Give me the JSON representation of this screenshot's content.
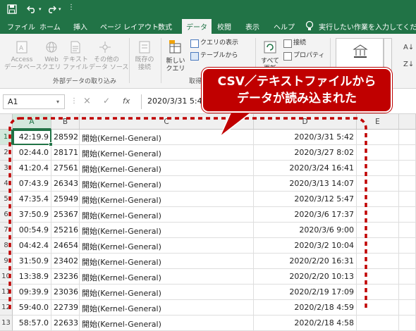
{
  "quick_access": {
    "save_icon": "save-icon",
    "undo_icon": "undo-icon",
    "redo_icon": "redo-icon",
    "customize_icon": "customize-icon"
  },
  "tabs": [
    "ファイル",
    "ホーム",
    "挿入",
    "ページ レイアウト",
    "数式",
    "データ",
    "校閲",
    "表示",
    "ヘルプ"
  ],
  "active_tab": "データ",
  "tell_me": "実行したい作業を入力してください",
  "ribbon": {
    "external_data": [
      "Access\nデータベース",
      "Web\nクエリ",
      "テキスト\nファイル",
      "その他の\nデータ ソース",
      "既存の\n接続"
    ],
    "external_data_group": "外部データの取り込み",
    "new_query": "新しい\nクエリ",
    "show_queries": "クエリの表示",
    "from_table": "テーブルから",
    "get_transform_group": "取得",
    "connections": "接続",
    "properties": "プロパティ",
    "refresh_all": "すべて\n更新"
  },
  "formula_bar": {
    "name_box": "A1",
    "cancel": "×",
    "enter": "✓",
    "fx": "fx",
    "value": "2020/3/31 5:42"
  },
  "callout": {
    "line1": "CSV／テキストファイルから",
    "line2": "データが読み込まれた"
  },
  "columns": [
    "A",
    "B",
    "C",
    "D",
    "E"
  ],
  "rows": [
    {
      "n": "1",
      "a": "42:19.9",
      "b": "28592",
      "c": "開始(Kernel-General)",
      "d": "2020/3/31 5:42"
    },
    {
      "n": "2",
      "a": "02:44.0",
      "b": "28171",
      "c": "開始(Kernel-General)",
      "d": "2020/3/27 8:02"
    },
    {
      "n": "3",
      "a": "41:20.4",
      "b": "27561",
      "c": "開始(Kernel-General)",
      "d": "2020/3/24 16:41"
    },
    {
      "n": "4",
      "a": "07:43.9",
      "b": "26343",
      "c": "開始(Kernel-General)",
      "d": "2020/3/13 14:07"
    },
    {
      "n": "5",
      "a": "47:35.4",
      "b": "25949",
      "c": "開始(Kernel-General)",
      "d": "2020/3/12 5:47"
    },
    {
      "n": "6",
      "a": "37:50.9",
      "b": "25367",
      "c": "開始(Kernel-General)",
      "d": "2020/3/6 17:37"
    },
    {
      "n": "7",
      "a": "00:54.9",
      "b": "25216",
      "c": "開始(Kernel-General)",
      "d": "2020/3/6 9:00"
    },
    {
      "n": "8",
      "a": "04:42.4",
      "b": "24654",
      "c": "開始(Kernel-General)",
      "d": "2020/3/2 10:04"
    },
    {
      "n": "9",
      "a": "31:50.9",
      "b": "23402",
      "c": "開始(Kernel-General)",
      "d": "2020/2/20 16:31"
    },
    {
      "n": "10",
      "a": "13:38.9",
      "b": "23236",
      "c": "開始(Kernel-General)",
      "d": "2020/2/20 10:13"
    },
    {
      "n": "11",
      "a": "09:39.9",
      "b": "23036",
      "c": "開始(Kernel-General)",
      "d": "2020/2/19 17:09"
    },
    {
      "n": "12",
      "a": "59:40.0",
      "b": "22739",
      "c": "開始(Kernel-General)",
      "d": "2020/2/18 4:59"
    },
    {
      "n": "13",
      "a": "58:57.0",
      "b": "22633",
      "c": "開始(Kernel-General)",
      "d": "2020/2/18 4:58"
    }
  ]
}
